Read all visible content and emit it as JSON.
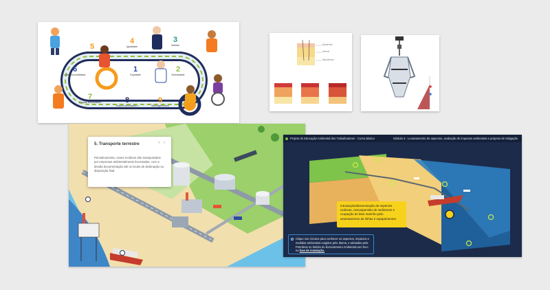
{
  "diversity_card": {
    "items": [
      {
        "num": "5",
        "label": "Equidade",
        "color": "#f59b1c"
      },
      {
        "num": "4",
        "label": "Igualdade",
        "color": "#f59b1c"
      },
      {
        "num": "3",
        "label": "Incluido",
        "color": "#1d9a8f"
      },
      {
        "num": "6",
        "label": "Interseccionalidade",
        "color": "#2f4aa0"
      },
      {
        "num": "1",
        "label": "Equidade",
        "color": "#2f4aa0"
      },
      {
        "num": "2",
        "label": "Diversidade",
        "color": "#8fbf3a"
      },
      {
        "num": "7",
        "label": "Grupos Minorizados",
        "color": "#8fbf3a"
      },
      {
        "num": "8",
        "label": "Grupos minorizados e interseccionalidade",
        "color": "#1f2d5c"
      },
      {
        "num": "9",
        "label": "Microagressões",
        "color": "#f59b1c"
      }
    ]
  },
  "skin_card": {
    "labels": [
      "Epiderme",
      "Derme",
      "Hipoderme"
    ]
  },
  "transport_card": {
    "popup_title": "5. Transporte terrestre",
    "popup_nav": "‹ ›",
    "popup_body": "Periodicamente, esses resíduos são transportados por empresas ambientalmente licenciadas, com a devida documentação até os locais de destinação ou disposição final."
  },
  "offshore_card": {
    "topbar_title": "Projeto de Educação Ambiental dos Trabalhadores - Curso Básico",
    "topbar_module": "Módulo 3 - Levantamento de aspectos, avaliação de impactos ambientais e projetos de mitigação",
    "callout_text": "Introdução/disseminação de espécies exóticas, ressuspensão de sedimento e ocupação do leito marinho pelo assentamento de linhas e equipamentos.",
    "info_text": "Clique nos círculos para conhecer os aspectos, impactos e medidas ambientais exigidos pelo Ibama, e adotadas pela Petrobras no âmbito do licenciamento Ambiental.com foco na ",
    "info_highlight": "fase de instalação."
  }
}
